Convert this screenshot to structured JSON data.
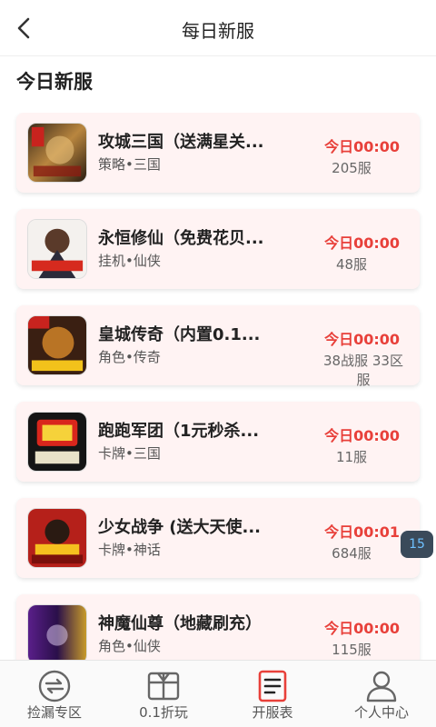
{
  "header": {
    "title": "每日新服"
  },
  "section": {
    "title": "今日新服"
  },
  "colors": {
    "accent": "#e8403a",
    "card_bg": "#fff3f3",
    "badge_bg": "#3a4a5a",
    "badge_text": "#6ec1ff"
  },
  "games": [
    {
      "name": "攻城三国（送满星关...",
      "tags": "策略•三国",
      "time": "今日00:00",
      "server": "205服",
      "icon": "game-thumbnail-gongcheng"
    },
    {
      "name": "永恒修仙（免费花贝...",
      "tags": "挂机•仙侠",
      "time": "今日00:00",
      "server": "48服",
      "icon": "game-thumbnail-yongheng"
    },
    {
      "name": "皇城传奇（内置0.1...",
      "tags": "角色•传奇",
      "time": "今日00:00",
      "server": "38战服 33区服",
      "icon": "game-thumbnail-huangcheng"
    },
    {
      "name": "跑跑军团（1元秒杀...",
      "tags": "卡牌•三国",
      "time": "今日00:00",
      "server": "11服",
      "icon": "game-thumbnail-paopao"
    },
    {
      "name": "少女战争 (送大天使...",
      "tags": "卡牌•神话",
      "time": "今日00:01",
      "server": "684服",
      "icon": "game-thumbnail-shaonv"
    },
    {
      "name": "神魔仙尊（地藏刷充）",
      "tags": "角色•仙侠",
      "time": "今日00:00",
      "server": "115服",
      "icon": "game-thumbnail-shenmo"
    }
  ],
  "float_badge": {
    "label": "15"
  },
  "tabbar": {
    "items": [
      {
        "label": "捡漏专区",
        "icon": "recycle-arrows-icon"
      },
      {
        "label": "0.1折玩",
        "icon": "gift-box-icon"
      },
      {
        "label": "开服表",
        "icon": "server-list-icon",
        "active": true
      },
      {
        "label": "个人中心",
        "icon": "user-icon"
      }
    ]
  }
}
